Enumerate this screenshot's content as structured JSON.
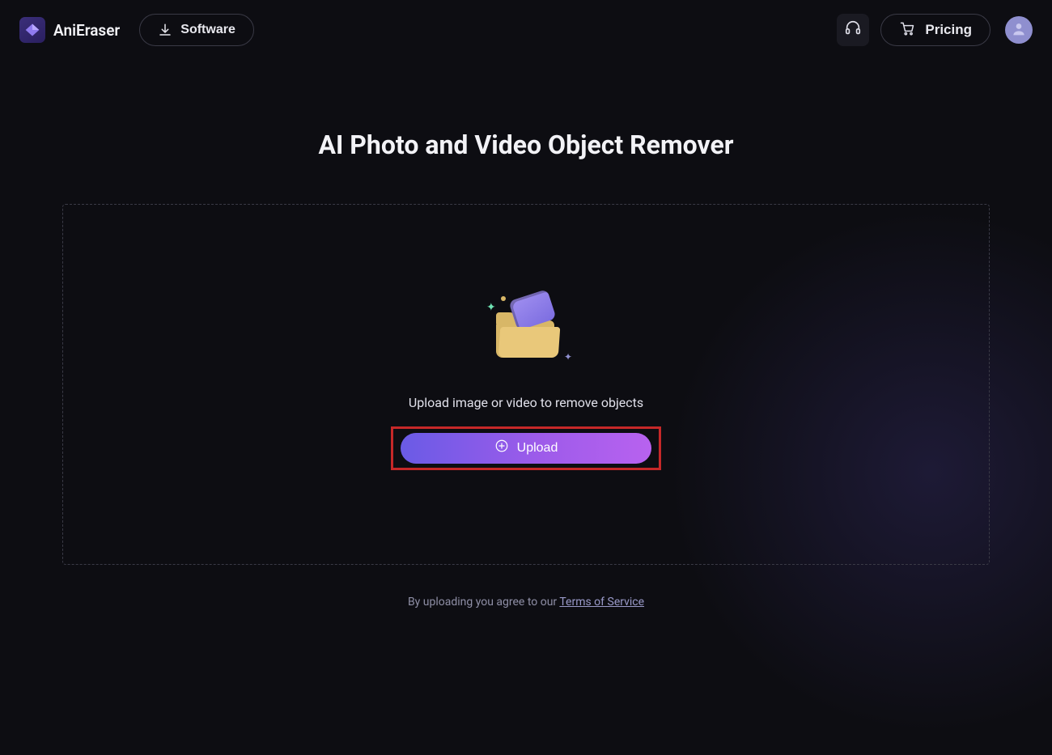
{
  "brand": {
    "name": "AniEraser"
  },
  "header": {
    "software_label": "Software",
    "pricing_label": "Pricing"
  },
  "main": {
    "title": "AI Photo and Video Object Remover",
    "instructions": "Upload image or video to remove objects",
    "upload_label": "Upload",
    "tos_prefix": "By uploading you agree to our ",
    "tos_link": "Terms of Service"
  }
}
